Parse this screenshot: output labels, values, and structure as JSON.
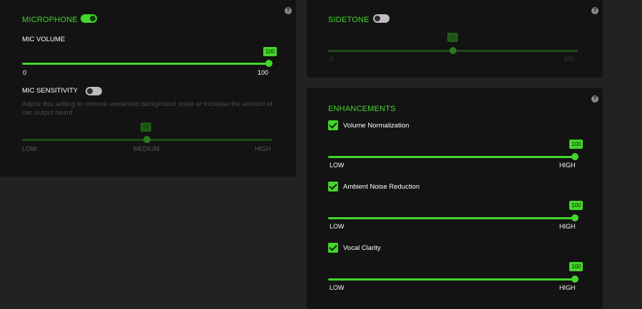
{
  "help_glyph": "?",
  "microphone": {
    "title": "MICROPHONE",
    "toggle_on": true,
    "mic_volume": {
      "label": "MIC VOLUME",
      "value": "100",
      "value_num": 100,
      "min_label": "0",
      "max_label": "100"
    },
    "mic_sensitivity": {
      "label": "MIC SENSITIVITY",
      "toggle_on": false,
      "description": "Adjust this setting to remove unwanted background noise or increase the amount of mic output heard",
      "value": "50",
      "value_num": 50,
      "low_label": "LOW",
      "medium_label": "MEDIUM",
      "high_label": "HIGH"
    }
  },
  "sidetone": {
    "title": "SIDETONE",
    "toggle_on": false,
    "value": "50",
    "value_num": 50,
    "min_label": "0",
    "max_label": "100"
  },
  "enhancements": {
    "title": "ENHANCEMENTS",
    "items": [
      {
        "label": "Volume Normalization",
        "checked": true,
        "value": "100",
        "low_label": "LOW",
        "high_label": "HIGH"
      },
      {
        "label": "Ambient Noise Reduction",
        "checked": true,
        "value": "100",
        "low_label": "LOW",
        "high_label": "HIGH"
      },
      {
        "label": "Vocal Clarity",
        "checked": true,
        "value": "100",
        "low_label": "LOW",
        "high_label": "HIGH"
      }
    ]
  },
  "colors": {
    "accent": "#44d62c",
    "accent_dim": "#1f5d17",
    "panel": "#131313",
    "background": "#222222"
  }
}
